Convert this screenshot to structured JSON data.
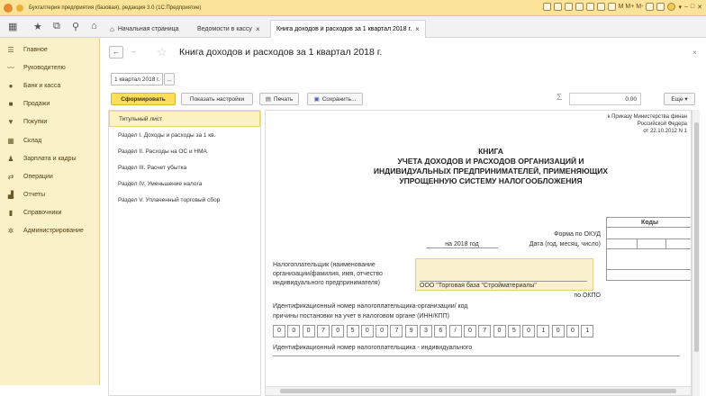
{
  "window": {
    "title": "Бухгалтерия предприятия (базовая), редакция 3.0  (1С:Предприятие)",
    "title_right": "M  M+  M-"
  },
  "tabs": {
    "home": "Начальная страница",
    "tab1": "Ведомости в кассу",
    "tab2": "Книга доходов и расходов за 1 квартал 2018 г.",
    "close": "×"
  },
  "sidebar": {
    "items": [
      {
        "label": "Главное",
        "icon": "list-icon"
      },
      {
        "label": "Руководителю",
        "icon": "chart-icon"
      },
      {
        "label": "Банк и касса",
        "icon": "bank-icon"
      },
      {
        "label": "Продажи",
        "icon": "bag-icon"
      },
      {
        "label": "Покупки",
        "icon": "cart-icon"
      },
      {
        "label": "Склад",
        "icon": "warehouse-icon"
      },
      {
        "label": "Зарплата и кадры",
        "icon": "person-icon"
      },
      {
        "label": "Операции",
        "icon": "operations-icon"
      },
      {
        "label": "Отчеты",
        "icon": "report-icon"
      },
      {
        "label": "Справочники",
        "icon": "book-icon"
      },
      {
        "label": "Администрирование",
        "icon": "gear-icon"
      }
    ]
  },
  "main": {
    "title": "Книга доходов и расходов за 1 квартал 2018 г.",
    "close": "×",
    "period_value": "1 квартал 2018 г.",
    "period_btn": "...",
    "generate": "Сформировать",
    "show_settings": "Показать настройки",
    "print": "Печать",
    "save": "Сохранить...",
    "sum_symbol": "Σ",
    "sum_value": "0,00",
    "more": "Еще ▾"
  },
  "sections": [
    "Титульный лист",
    "Раздел I. Доходы и расходы за 1 кв.",
    "Раздел II. Расходы на ОС и НМА",
    "Раздел III. Расчет убытка",
    "Раздел IV. Уменьшение налога",
    "Раздел V. Уплаченный торговый сбор"
  ],
  "report": {
    "order1": "к Приказу Министерства финан",
    "order2": "Российской Федера",
    "order3": "от 22.10.2012 N 1",
    "h1": "КНИГА",
    "h2": "УЧЕТА ДОХОДОВ И РАСХОДОВ ОРГАНИЗАЦИЙ И",
    "h3": "ИНДИВИДУАЛЬНЫХ ПРЕДПРИНИМАТЕЛЕЙ, ПРИМЕНЯЮЩИХ",
    "h4": "УПРОЩЕННУЮ СИСТЕМУ НАЛОГООБЛОЖЕНИЯ",
    "codes": "Коды",
    "form_okud": "Форма по ОКУД",
    "year": "на 2018 год",
    "date": "Дата (год, месяц, число)",
    "payer1": "Налогоплательщик (наименование",
    "payer2": "организации/фамилия, имя, отчество",
    "payer3": "индивидуального предпринимателя)",
    "payer_value": "ООО \"Торговая база \"Стройматериалы\"",
    "okpo": "по ОКПО",
    "inn1": "Идентификационный номер налогоплательщика-организации/ код",
    "inn2": "причины постановки на учет в налоговом органе (ИНН/КПП)",
    "inn_cells": [
      "0",
      "0",
      "0",
      "7",
      "0",
      "5",
      "0",
      "0",
      "7",
      "9",
      "3",
      "6",
      "/",
      "0",
      "7",
      "0",
      "5",
      "0",
      "1",
      "0",
      "0",
      "1"
    ],
    "ip_inn": "Идентификационный номер налогоплательщика - индивидуального"
  }
}
